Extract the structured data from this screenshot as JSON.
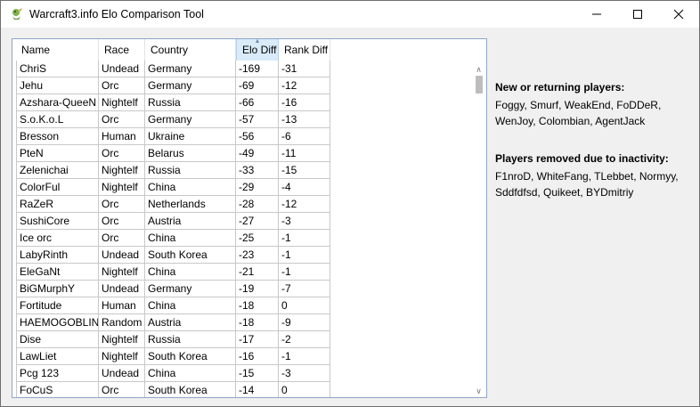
{
  "window": {
    "title": "Warcraft3.info Elo Comparison Tool"
  },
  "columns": [
    "Name",
    "Race",
    "Country",
    "Elo Diff",
    "Rank Diff"
  ],
  "rows": [
    [
      "ChriS",
      "Undead",
      "Germany",
      "-169",
      "-31"
    ],
    [
      "Jehu",
      "Orc",
      "Germany",
      "-69",
      "-12"
    ],
    [
      "Azshara-QueeN",
      "Nightelf",
      "Russia",
      "-66",
      "-16"
    ],
    [
      "S.o.K.o.L",
      "Orc",
      "Germany",
      "-57",
      "-13"
    ],
    [
      "Bresson",
      "Human",
      "Ukraine",
      "-56",
      "-6"
    ],
    [
      "PteN",
      "Orc",
      "Belarus",
      "-49",
      "-11"
    ],
    [
      "Zelenichai",
      "Nightelf",
      "Russia",
      "-33",
      "-15"
    ],
    [
      "ColorFul",
      "Nightelf",
      "China",
      "-29",
      "-4"
    ],
    [
      "RaZeR",
      "Orc",
      "Netherlands",
      "-28",
      "-12"
    ],
    [
      "SushiCore",
      "Orc",
      "Austria",
      "-27",
      "-3"
    ],
    [
      "Ice orc",
      "Orc",
      "China",
      "-25",
      "-1"
    ],
    [
      "LabyRinth",
      "Undead",
      "South Korea",
      "-23",
      "-1"
    ],
    [
      "EleGaNt",
      "Nightelf",
      "China",
      "-21",
      "-1"
    ],
    [
      "BiGMurphY",
      "Undead",
      "Germany",
      "-19",
      "-7"
    ],
    [
      "Fortitude",
      "Human",
      "China",
      "-18",
      "0"
    ],
    [
      "HAEMOGOBLIN",
      "Random",
      "Austria",
      "-18",
      "-9"
    ],
    [
      "Dise",
      "Nightelf",
      "Russia",
      "-17",
      "-2"
    ],
    [
      "LawLiet",
      "Nightelf",
      "South Korea",
      "-16",
      "-1"
    ],
    [
      "Pcg 123",
      "Undead",
      "China",
      "-15",
      "-3"
    ],
    [
      "FoCuS",
      "Orc",
      "South Korea",
      "-14",
      "0"
    ]
  ],
  "sort": {
    "column": "Elo Diff",
    "direction": "ascending"
  },
  "side": {
    "new_title": "New or returning players:",
    "new_players": "Foggy, Smurf, WeakEnd, FoDDeR, WenJoy, Colombian, AgentJack",
    "removed_title": "Players removed due to inactivity:",
    "removed_players": "F1nroD, WhiteFang, TLebbet, Normyy, Sddfdfsd, Quikeet, BYDmitriy"
  },
  "icons": {
    "app": "orc-peon-icon",
    "minimize": "minimize-icon",
    "maximize": "maximize-icon",
    "close": "close-icon"
  }
}
